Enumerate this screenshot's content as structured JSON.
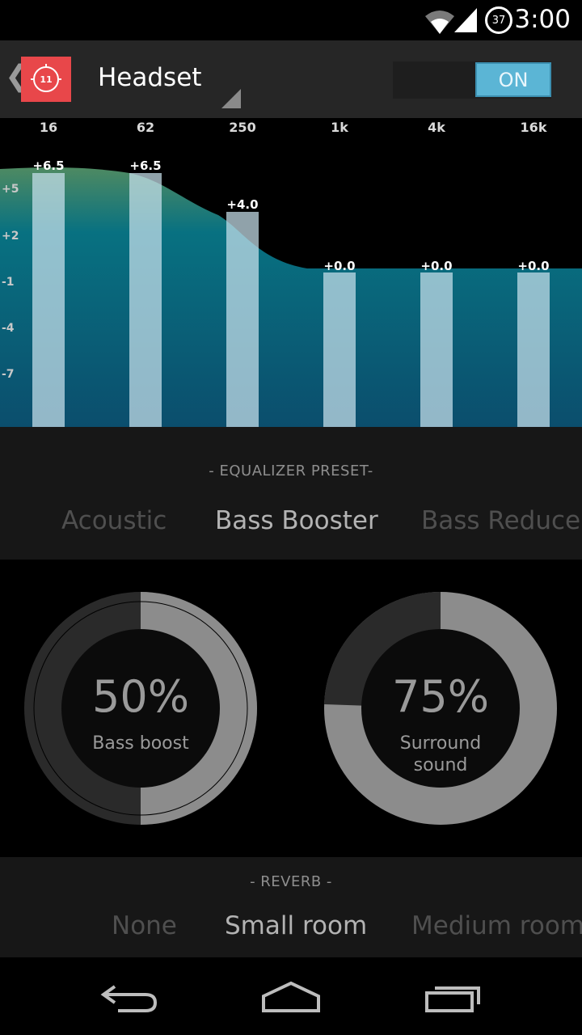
{
  "status_bar": {
    "time": "3:00",
    "battery_level": "37"
  },
  "action_bar": {
    "title": "Headset",
    "toggle_label": "ON"
  },
  "eq": {
    "bands": [
      {
        "freq": "16",
        "gain_label": "+6.5",
        "gain": 6.5
      },
      {
        "freq": "62",
        "gain_label": "+6.5",
        "gain": 6.5
      },
      {
        "freq": "250",
        "gain_label": "+4.0",
        "gain": 4.0
      },
      {
        "freq": "1k",
        "gain_label": "+0.0",
        "gain": 0.0
      },
      {
        "freq": "4k",
        "gain_label": "+0.0",
        "gain": 0.0
      },
      {
        "freq": "16k",
        "gain_label": "+0.0",
        "gain": 0.0
      }
    ],
    "db_ticks": [
      "+5",
      "+2",
      "-1",
      "-4",
      "-7"
    ]
  },
  "presets": {
    "heading": "- EQUALIZER PRESET-",
    "items": [
      "Acoustic",
      "Bass Booster",
      "Bass Reducer"
    ],
    "selected": "Bass Booster"
  },
  "knobs": {
    "bass": {
      "value_label": "50%",
      "value": 0.5,
      "label": "Bass boost"
    },
    "surround": {
      "value_label": "75%",
      "value": 0.75,
      "label_line1": "Surround",
      "label_line2": "sound"
    }
  },
  "reverb": {
    "heading": "- REVERB -",
    "items": [
      "None",
      "Small room",
      "Medium room"
    ],
    "selected": "Small room"
  },
  "colors": {
    "accent": "#5bb5d5",
    "app_icon": "#e8474a",
    "eq_fill_top": "#0b7585",
    "eq_fill_bottom": "#0b4f6f"
  },
  "icons": [
    "wifi-icon",
    "signal-icon",
    "battery-icon",
    "back-icon",
    "home-icon",
    "recents-icon"
  ]
}
